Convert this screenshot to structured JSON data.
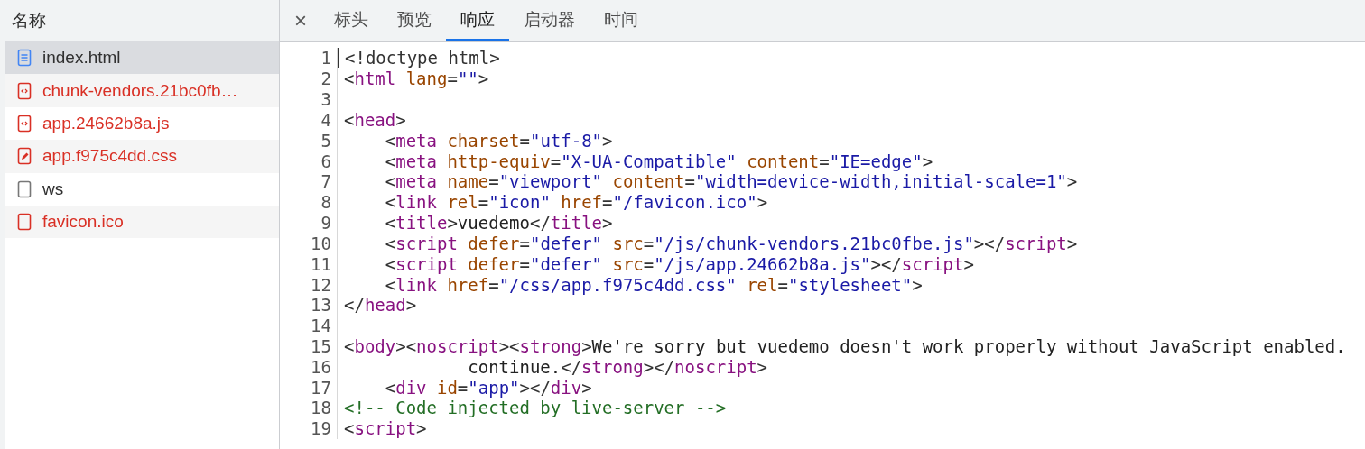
{
  "sidebar": {
    "header": "名称",
    "items": [
      {
        "name": "index.html",
        "kind": "document",
        "failed": false,
        "selected": true
      },
      {
        "name": "chunk-vendors.21bc0fb…",
        "kind": "script",
        "failed": true,
        "selected": false
      },
      {
        "name": "app.24662b8a.js",
        "kind": "script",
        "failed": true,
        "selected": false
      },
      {
        "name": "app.f975c4dd.css",
        "kind": "stylesheet",
        "failed": true,
        "selected": false
      },
      {
        "name": "ws",
        "kind": "blank",
        "failed": false,
        "selected": false
      },
      {
        "name": "favicon.ico",
        "kind": "blank",
        "failed": true,
        "selected": false
      }
    ]
  },
  "tabs": {
    "close": "×",
    "items": [
      {
        "label": "标头",
        "selected": false
      },
      {
        "label": "预览",
        "selected": false
      },
      {
        "label": "响应",
        "selected": true
      },
      {
        "label": "启动器",
        "selected": false
      },
      {
        "label": "时间",
        "selected": false
      }
    ]
  },
  "code": [
    {
      "number": "1",
      "tokens": [
        {
          "kind": "p",
          "text": "<!doctype html>"
        }
      ]
    },
    {
      "number": "2",
      "tokens": [
        {
          "kind": "p",
          "text": "<"
        },
        {
          "kind": "t",
          "text": "html"
        },
        {
          "kind": "a",
          "text": " lang"
        },
        {
          "kind": "p",
          "text": "="
        },
        {
          "kind": "v",
          "text": "\"\""
        },
        {
          "kind": "p",
          "text": ">"
        }
      ]
    },
    {
      "number": "3"
    },
    {
      "number": "4",
      "tokens": [
        {
          "kind": "p",
          "text": "<"
        },
        {
          "kind": "t",
          "text": "head"
        },
        {
          "kind": "p",
          "text": ">"
        }
      ]
    },
    {
      "number": "5",
      "tokens": [
        {
          "kind": "p",
          "text": "    <"
        },
        {
          "kind": "t",
          "text": "meta"
        },
        {
          "kind": "a",
          "text": " charset"
        },
        {
          "kind": "p",
          "text": "="
        },
        {
          "kind": "v",
          "text": "\"utf-8\""
        },
        {
          "kind": "p",
          "text": ">"
        }
      ]
    },
    {
      "number": "6",
      "tokens": [
        {
          "kind": "p",
          "text": "    <"
        },
        {
          "kind": "t",
          "text": "meta"
        },
        {
          "kind": "a",
          "text": " http-equiv"
        },
        {
          "kind": "p",
          "text": "="
        },
        {
          "kind": "v",
          "text": "\"X-UA-Compatible\""
        },
        {
          "kind": "a",
          "text": " content"
        },
        {
          "kind": "p",
          "text": "="
        },
        {
          "kind": "v",
          "text": "\"IE=edge\""
        },
        {
          "kind": "p",
          "text": ">"
        }
      ]
    },
    {
      "number": "7",
      "tokens": [
        {
          "kind": "p",
          "text": "    <"
        },
        {
          "kind": "t",
          "text": "meta"
        },
        {
          "kind": "a",
          "text": " name"
        },
        {
          "kind": "p",
          "text": "="
        },
        {
          "kind": "v",
          "text": "\"viewport\""
        },
        {
          "kind": "a",
          "text": " content"
        },
        {
          "kind": "p",
          "text": "="
        },
        {
          "kind": "v",
          "text": "\"width=device-width,initial-scale=1\""
        },
        {
          "kind": "p",
          "text": ">"
        }
      ]
    },
    {
      "number": "8",
      "tokens": [
        {
          "kind": "p",
          "text": "    <"
        },
        {
          "kind": "t",
          "text": "link"
        },
        {
          "kind": "a",
          "text": " rel"
        },
        {
          "kind": "p",
          "text": "="
        },
        {
          "kind": "v",
          "text": "\"icon\""
        },
        {
          "kind": "a",
          "text": " href"
        },
        {
          "kind": "p",
          "text": "="
        },
        {
          "kind": "v",
          "text": "\"/favicon.ico\""
        },
        {
          "kind": "p",
          "text": ">"
        }
      ]
    },
    {
      "number": "9",
      "tokens": [
        {
          "kind": "p",
          "text": "    <"
        },
        {
          "kind": "t",
          "text": "title"
        },
        {
          "kind": "p",
          "text": ">"
        },
        {
          "kind": "x",
          "text": "vuedemo"
        },
        {
          "kind": "p",
          "text": "</"
        },
        {
          "kind": "t",
          "text": "title"
        },
        {
          "kind": "p",
          "text": ">"
        }
      ]
    },
    {
      "number": "10",
      "tokens": [
        {
          "kind": "p",
          "text": "    <"
        },
        {
          "kind": "t",
          "text": "script"
        },
        {
          "kind": "a",
          "text": " defer"
        },
        {
          "kind": "p",
          "text": "="
        },
        {
          "kind": "v",
          "text": "\"defer\""
        },
        {
          "kind": "a",
          "text": " src"
        },
        {
          "kind": "p",
          "text": "="
        },
        {
          "kind": "v",
          "text": "\"/js/chunk-vendors.21bc0fbe.js\""
        },
        {
          "kind": "p",
          "text": "></"
        },
        {
          "kind": "t",
          "text": "script"
        },
        {
          "kind": "p",
          "text": ">"
        }
      ]
    },
    {
      "number": "11",
      "tokens": [
        {
          "kind": "p",
          "text": "    <"
        },
        {
          "kind": "t",
          "text": "script"
        },
        {
          "kind": "a",
          "text": " defer"
        },
        {
          "kind": "p",
          "text": "="
        },
        {
          "kind": "v",
          "text": "\"defer\""
        },
        {
          "kind": "a",
          "text": " src"
        },
        {
          "kind": "p",
          "text": "="
        },
        {
          "kind": "v",
          "text": "\"/js/app.24662b8a.js\""
        },
        {
          "kind": "p",
          "text": "></"
        },
        {
          "kind": "t",
          "text": "script"
        },
        {
          "kind": "p",
          "text": ">"
        }
      ]
    },
    {
      "number": "12",
      "tokens": [
        {
          "kind": "p",
          "text": "    <"
        },
        {
          "kind": "t",
          "text": "link"
        },
        {
          "kind": "a",
          "text": " href"
        },
        {
          "kind": "p",
          "text": "="
        },
        {
          "kind": "v",
          "text": "\"/css/app.f975c4dd.css\""
        },
        {
          "kind": "a",
          "text": " rel"
        },
        {
          "kind": "p",
          "text": "="
        },
        {
          "kind": "v",
          "text": "\"stylesheet\""
        },
        {
          "kind": "p",
          "text": ">"
        }
      ]
    },
    {
      "number": "13",
      "tokens": [
        {
          "kind": "p",
          "text": "</"
        },
        {
          "kind": "t",
          "text": "head"
        },
        {
          "kind": "p",
          "text": ">"
        }
      ]
    },
    {
      "number": "14"
    },
    {
      "number": "15",
      "tokens": [
        {
          "kind": "p",
          "text": "<"
        },
        {
          "kind": "t",
          "text": "body"
        },
        {
          "kind": "p",
          "text": "><"
        },
        {
          "kind": "t",
          "text": "noscript"
        },
        {
          "kind": "p",
          "text": "><"
        },
        {
          "kind": "t",
          "text": "strong"
        },
        {
          "kind": "p",
          "text": ">"
        },
        {
          "kind": "x",
          "text": "We're sorry but vuedemo doesn't work properly without JavaScript enabled."
        }
      ]
    },
    {
      "number": "16",
      "tokens": [
        {
          "kind": "x",
          "text": "            continue."
        },
        {
          "kind": "p",
          "text": "</"
        },
        {
          "kind": "t",
          "text": "strong"
        },
        {
          "kind": "p",
          "text": "></"
        },
        {
          "kind": "t",
          "text": "noscript"
        },
        {
          "kind": "p",
          "text": ">"
        }
      ]
    },
    {
      "number": "17",
      "tokens": [
        {
          "kind": "p",
          "text": "    <"
        },
        {
          "kind": "t",
          "text": "div"
        },
        {
          "kind": "a",
          "text": " id"
        },
        {
          "kind": "p",
          "text": "="
        },
        {
          "kind": "v",
          "text": "\"app\""
        },
        {
          "kind": "p",
          "text": "></"
        },
        {
          "kind": "t",
          "text": "div"
        },
        {
          "kind": "p",
          "text": ">"
        }
      ]
    },
    {
      "number": "18",
      "tokens": [
        {
          "kind": "c",
          "text": "<!-- Code injected by live-server -->"
        }
      ]
    },
    {
      "number": "19",
      "tokens": [
        {
          "kind": "p",
          "text": "<"
        },
        {
          "kind": "t",
          "text": "script"
        },
        {
          "kind": "p",
          "text": ">"
        }
      ]
    }
  ]
}
